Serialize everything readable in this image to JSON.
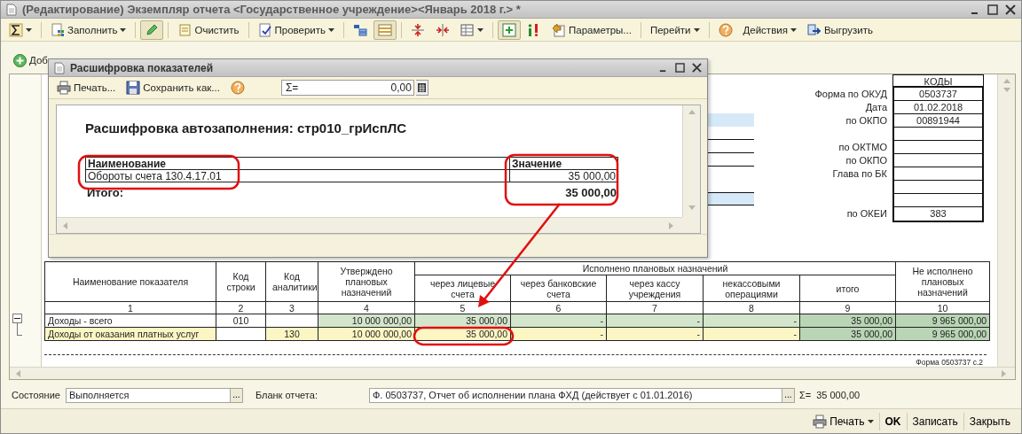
{
  "window": {
    "title": "(Редактирование) Экземпляр отчета <Государственное учреждение><Январь 2018 г.> *"
  },
  "toolbar": {
    "groups": [
      [
        {
          "kind": "sum",
          "dropdown": true,
          "pressed": false
        }
      ],
      [
        {
          "kind": "fill",
          "label": "Заполнить",
          "dropdown": true,
          "pressed": false
        }
      ],
      [
        {
          "kind": "edit",
          "dropdown": false,
          "pressed": true
        }
      ],
      [
        {
          "kind": "clear",
          "label": "Очистить",
          "dropdown": false,
          "pressed": false
        }
      ],
      [
        {
          "kind": "check",
          "label": "Проверить",
          "dropdown": true,
          "pressed": false
        }
      ],
      [
        {
          "kind": "group",
          "dropdown": false,
          "pressed": false
        },
        {
          "kind": "table",
          "dropdown": false,
          "pressed": true
        }
      ],
      [
        {
          "kind": "collapse",
          "dropdown": false,
          "pressed": false
        },
        {
          "kind": "expand",
          "dropdown": false,
          "pressed": false
        },
        {
          "kind": "cells",
          "dropdown": true,
          "pressed": false
        }
      ],
      [
        {
          "kind": "add",
          "dropdown": false,
          "pressed": true
        },
        {
          "kind": "warn",
          "dropdown": false,
          "pressed": false
        },
        {
          "kind": "params",
          "label": "Параметры...",
          "dropdown": false,
          "pressed": false
        }
      ],
      [
        {
          "kind": "goto",
          "label": "Перейти",
          "dropdown": true,
          "pressed": false
        }
      ],
      [
        {
          "kind": "help",
          "dropdown": false,
          "pressed": false
        },
        {
          "kind": "actions",
          "label": "Действия",
          "dropdown": true,
          "pressed": false
        },
        {
          "kind": "export",
          "label": "Выгрузить",
          "dropdown": false,
          "pressed": false
        }
      ]
    ]
  },
  "secondary_toolbar": {
    "add_button": "Доб"
  },
  "codes": {
    "header": "КОДЫ",
    "rows": [
      {
        "kind": "entry",
        "label": "Форма по ОКУД",
        "value": "0503737"
      },
      {
        "kind": "entry",
        "label": "Дата",
        "value": "01.02.2018"
      },
      {
        "kind": "entry",
        "label": "по ОКПО",
        "value": "00891944"
      },
      {
        "kind": "blank"
      },
      {
        "kind": "entry",
        "label": "по ОКТМО"
      },
      {
        "kind": "entry",
        "label": "по ОКПО"
      },
      {
        "kind": "entry",
        "label": "Глава по БК"
      },
      {
        "kind": "blank"
      },
      {
        "kind": "blank"
      },
      {
        "kind": "entry",
        "label": "по ОКЕИ",
        "value": "383"
      }
    ]
  },
  "report_table": {
    "group_header": "Исполнено плановых назначений",
    "columns": {
      "name": "Наименование показателя",
      "line_code": "Код строки",
      "analytic_code": "Код аналитики",
      "approved": "Утверждено плановых назначений",
      "via_personal_accounts": "через лицевые счета",
      "via_bank_accounts": "через банковские счета",
      "via_cash_desk": "через кассу учреждения",
      "non_cash": "некассовыми операциями",
      "total": "итого",
      "not_executed": "Не исполнено плановых назначений"
    },
    "column_numbers": [
      "1",
      "2",
      "3",
      "4",
      "5",
      "6",
      "7",
      "8",
      "9",
      "10"
    ],
    "rows": [
      {
        "kind": "total",
        "expanded": true,
        "name": "Доходы - всего",
        "line_code": "010",
        "approved": "10 000 000,00",
        "via_personal_accounts": "35 000,00",
        "via_bank_accounts": "-",
        "via_cash_desk": "-",
        "non_cash": "-",
        "total": "35 000,00",
        "not_executed": "9 965 000,00"
      },
      {
        "kind": "detail",
        "name": "Доходы от оказания платных услуг",
        "analytic_code": "130",
        "approved": "10 000 000,00",
        "via_personal_accounts": "35 000,00",
        "via_bank_accounts": "-",
        "via_cash_desk": "-",
        "non_cash": "-",
        "total": "35 000,00",
        "not_executed": "9 965 000,00"
      }
    ],
    "page_label": "Форма 0503737  с.2"
  },
  "footer": {
    "status": {
      "label": "Состояние",
      "value": "Выполняется",
      "button": "..."
    },
    "form_blank": {
      "label": "Бланк отчета:",
      "value": "Ф. 0503737, Отчет об исполнении плана ФХД (действует с 01.01.2016)",
      "button": "..."
    },
    "sum": {
      "label": "Σ=",
      "value": "35 000,00"
    }
  },
  "buttons": [
    {
      "kind": "menu",
      "label": "Печать"
    },
    {
      "kind": "default",
      "label": "OK"
    },
    {
      "kind": "plain",
      "label": "Записать"
    },
    {
      "kind": "plain",
      "label": "Закрыть"
    }
  ],
  "dialog": {
    "title": "Расшифровка показателей",
    "toolbar": [
      {
        "kind": "print",
        "label": "Печать..."
      },
      {
        "kind": "save",
        "label": "Сохранить как..."
      },
      {
        "kind": "help"
      }
    ],
    "sum_field": {
      "label": "Σ=",
      "value": "0,00"
    },
    "heading": "Расшифровка автозаполнения: стр010_грИспЛС",
    "table": {
      "columns": [
        "Наименование",
        "Значение"
      ],
      "rows": [
        {
          "name": "Обороты счета 130.4.17.01",
          "value": "35 000,00"
        }
      ],
      "total": {
        "label": "Итого:",
        "value": "35 000,00"
      }
    }
  }
}
